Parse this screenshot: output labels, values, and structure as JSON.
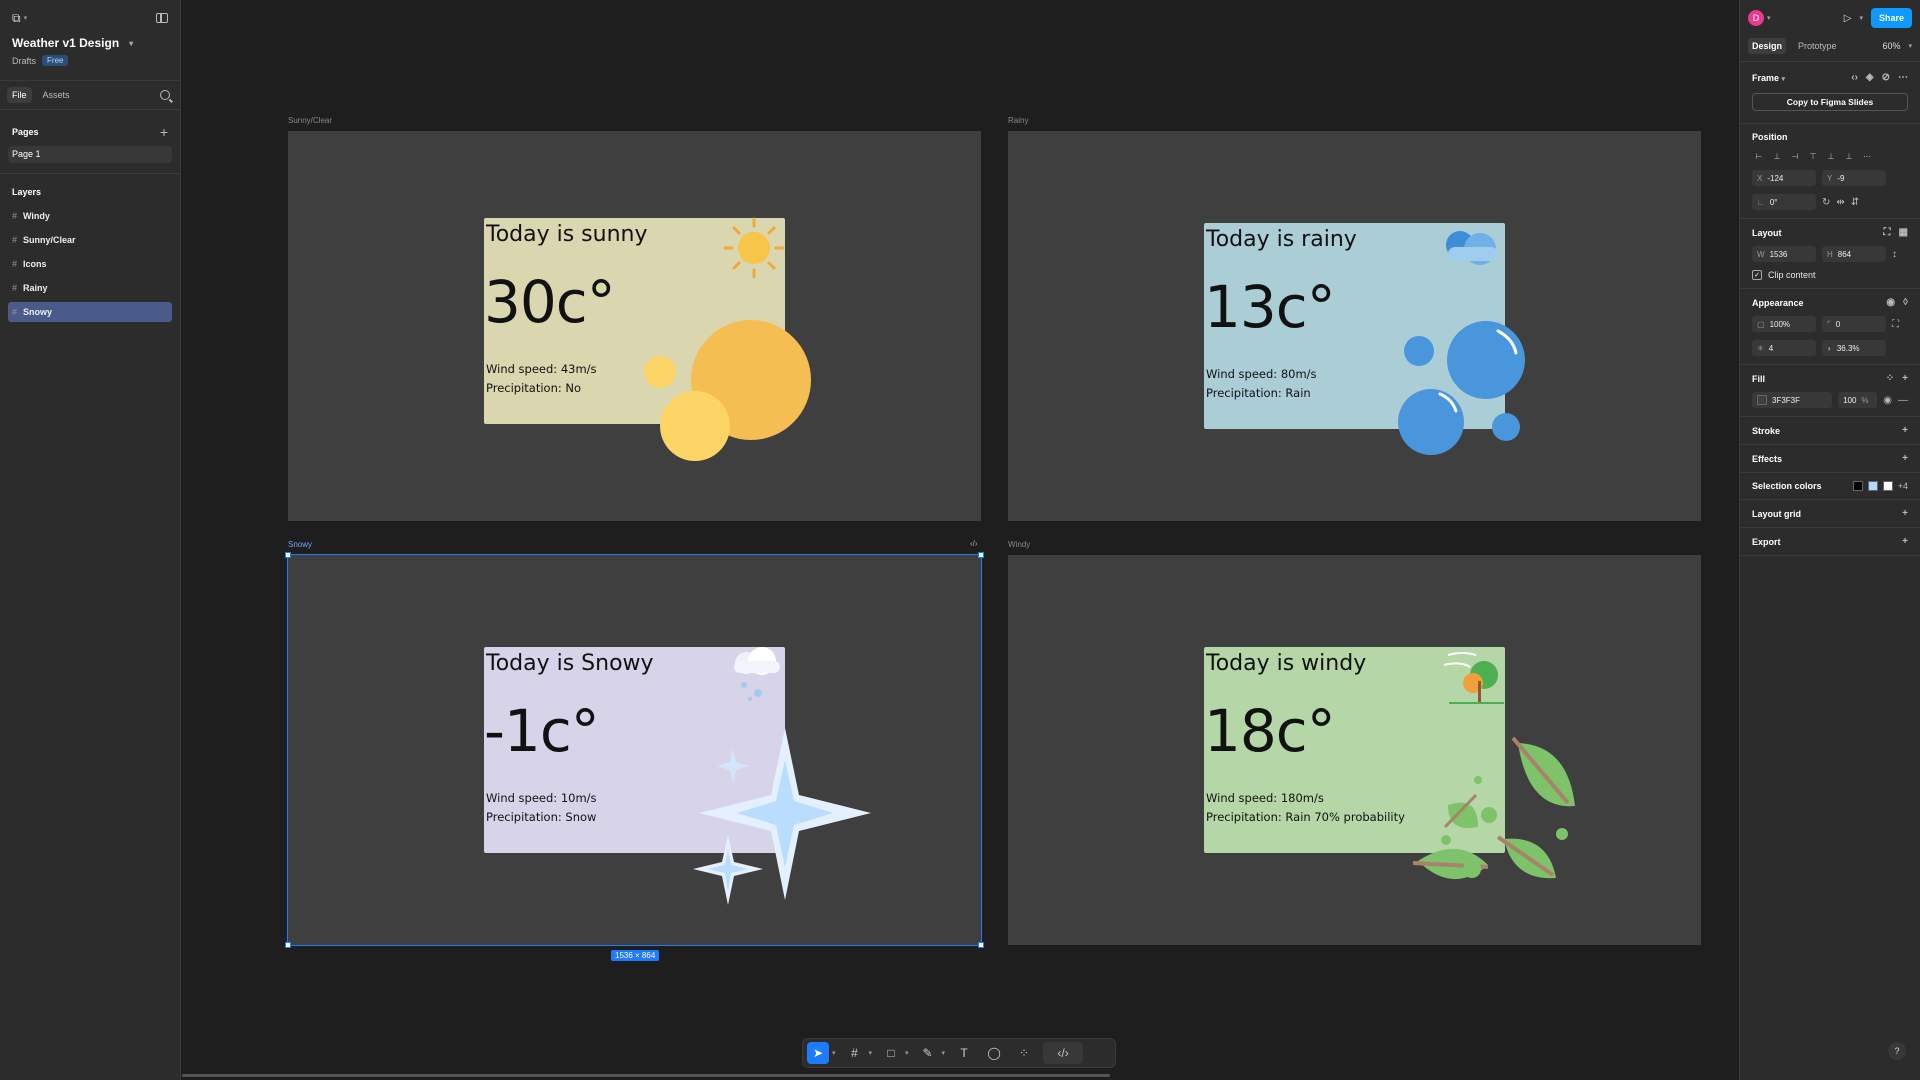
{
  "file": {
    "title": "Weather v1 Design",
    "location": "Drafts",
    "plan": "Free"
  },
  "left_tabs": {
    "file": "File",
    "assets": "Assets"
  },
  "pages": {
    "heading": "Pages",
    "items": [
      "Page 1"
    ]
  },
  "layers": {
    "heading": "Layers",
    "items": [
      "Windy",
      "Sunny/Clear",
      "Icons",
      "Rainy",
      "Snowy"
    ],
    "selected": "Snowy"
  },
  "frames": {
    "sunny": {
      "label": "Sunny/Clear",
      "title": "Today is sunny",
      "temp": "30c°",
      "wind": "Wind speed: 43m/s",
      "precip": "Precipitation: No",
      "card_color": "#d9d6b0"
    },
    "rainy": {
      "label": "Rainy",
      "title": "Today is rainy",
      "temp": "13c°",
      "wind": "Wind speed: 80m/s",
      "precip": "Precipitation: Rain",
      "card_color": "#abcdd6"
    },
    "snowy": {
      "label": "Snowy",
      "title": "Today is Snowy",
      "temp": "-1c°",
      "wind": "Wind speed: 10m/s",
      "precip": "Precipitation: Snow",
      "card_color": "#d7d4ea"
    },
    "windy": {
      "label": "Windy",
      "title": "Today is windy",
      "temp": "18c°",
      "wind": "Wind speed: 180m/s",
      "precip": "Precipitation: Rain 70% probability",
      "card_color": "#b5d6a7"
    }
  },
  "selection_dims": "1536 × 864",
  "toolbar": {
    "icons": [
      "move-tool",
      "frame-tool",
      "shape-tool",
      "pen-tool",
      "text-tool",
      "comment-tool",
      "actions-tool",
      "dev-mode-toggle"
    ]
  },
  "right": {
    "avatar": "D",
    "share": "Share",
    "tabs": {
      "design": "Design",
      "prototype": "Prototype"
    },
    "zoom": "60%",
    "frame_label": "Frame",
    "copy_slides": "Copy to Figma Slides",
    "position": {
      "heading": "Position",
      "x": "-124",
      "y": "-9",
      "rotation": "0°"
    },
    "layout": {
      "heading": "Layout",
      "w": "1536",
      "h": "864",
      "clip": "Clip content"
    },
    "appearance": {
      "heading": "Appearance",
      "opacity": "100%",
      "radius": "0",
      "blur": "4",
      "value2": "36.3%"
    },
    "fill": {
      "heading": "Fill",
      "hex": "3F3F3F",
      "opacity": "100",
      "pct": "%"
    },
    "stroke": "Stroke",
    "effects": "Effects",
    "selection_colors": {
      "heading": "Selection colors",
      "more": "+4",
      "colors": [
        "#000000",
        "#b3d9ff",
        "#ffffff"
      ]
    },
    "layout_grid": "Layout grid",
    "export": "Export"
  },
  "help": "?"
}
